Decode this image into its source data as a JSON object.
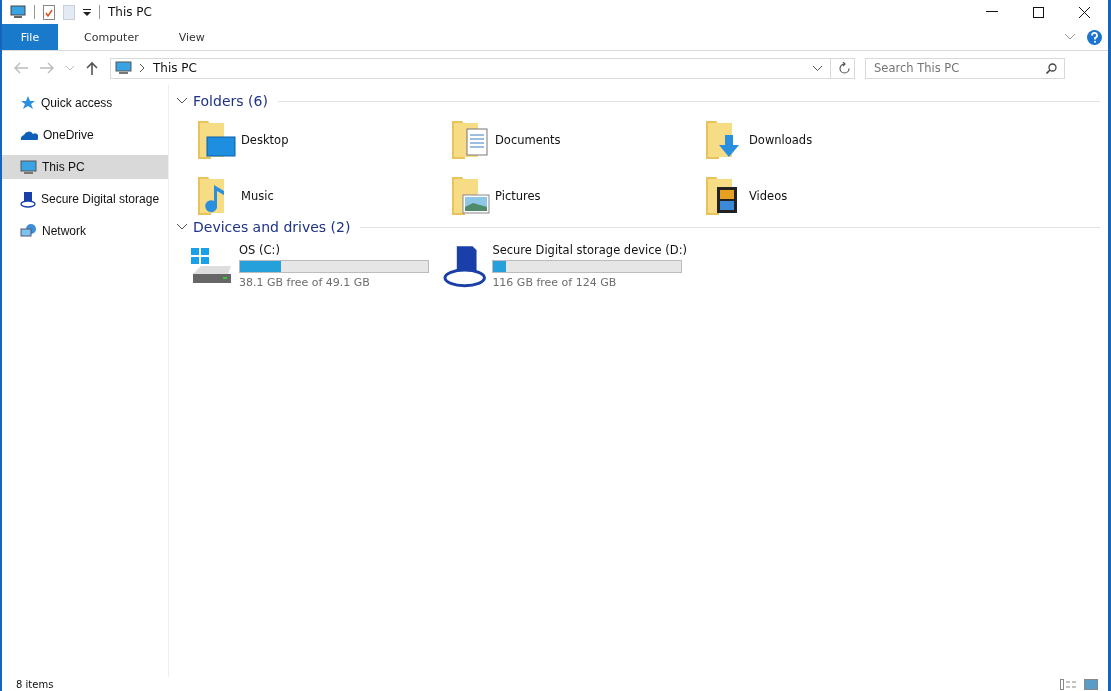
{
  "window": {
    "title": "This PC"
  },
  "ribbon_tabs": [
    {
      "label": "File",
      "selected": true
    },
    {
      "label": "Computer",
      "selected": false
    },
    {
      "label": "View",
      "selected": false
    }
  ],
  "address": {
    "path": "This PC"
  },
  "search": {
    "placeholder": "Search This PC"
  },
  "sidebar": {
    "items": [
      {
        "label": "Quick access",
        "kind": "star",
        "selected": false
      },
      {
        "label": "OneDrive",
        "kind": "cloud",
        "selected": false
      },
      {
        "label": "This PC",
        "kind": "pc",
        "selected": true
      },
      {
        "label": "Secure Digital storage",
        "kind": "sd",
        "selected": false
      },
      {
        "label": "Network",
        "kind": "network",
        "selected": false
      }
    ]
  },
  "folders": {
    "title": "Folders (6)",
    "items": [
      {
        "name": "Desktop",
        "kind": "desktop"
      },
      {
        "name": "Documents",
        "kind": "documents"
      },
      {
        "name": "Downloads",
        "kind": "downloads"
      },
      {
        "name": "Music",
        "kind": "music"
      },
      {
        "name": "Pictures",
        "kind": "pictures"
      },
      {
        "name": "Videos",
        "kind": "videos"
      }
    ]
  },
  "drives": {
    "title": "Devices and drives (2)",
    "items": [
      {
        "name": "OS (C:)",
        "kind": "disk",
        "level": 0.22,
        "free": "38.1 GB free of 49.1 GB"
      },
      {
        "name": "Secure Digital storage device (D:)",
        "kind": "sd",
        "level": 0.065,
        "free": "116 GB free of 124 GB"
      }
    ]
  },
  "status_bar": {
    "count": "8 items"
  }
}
